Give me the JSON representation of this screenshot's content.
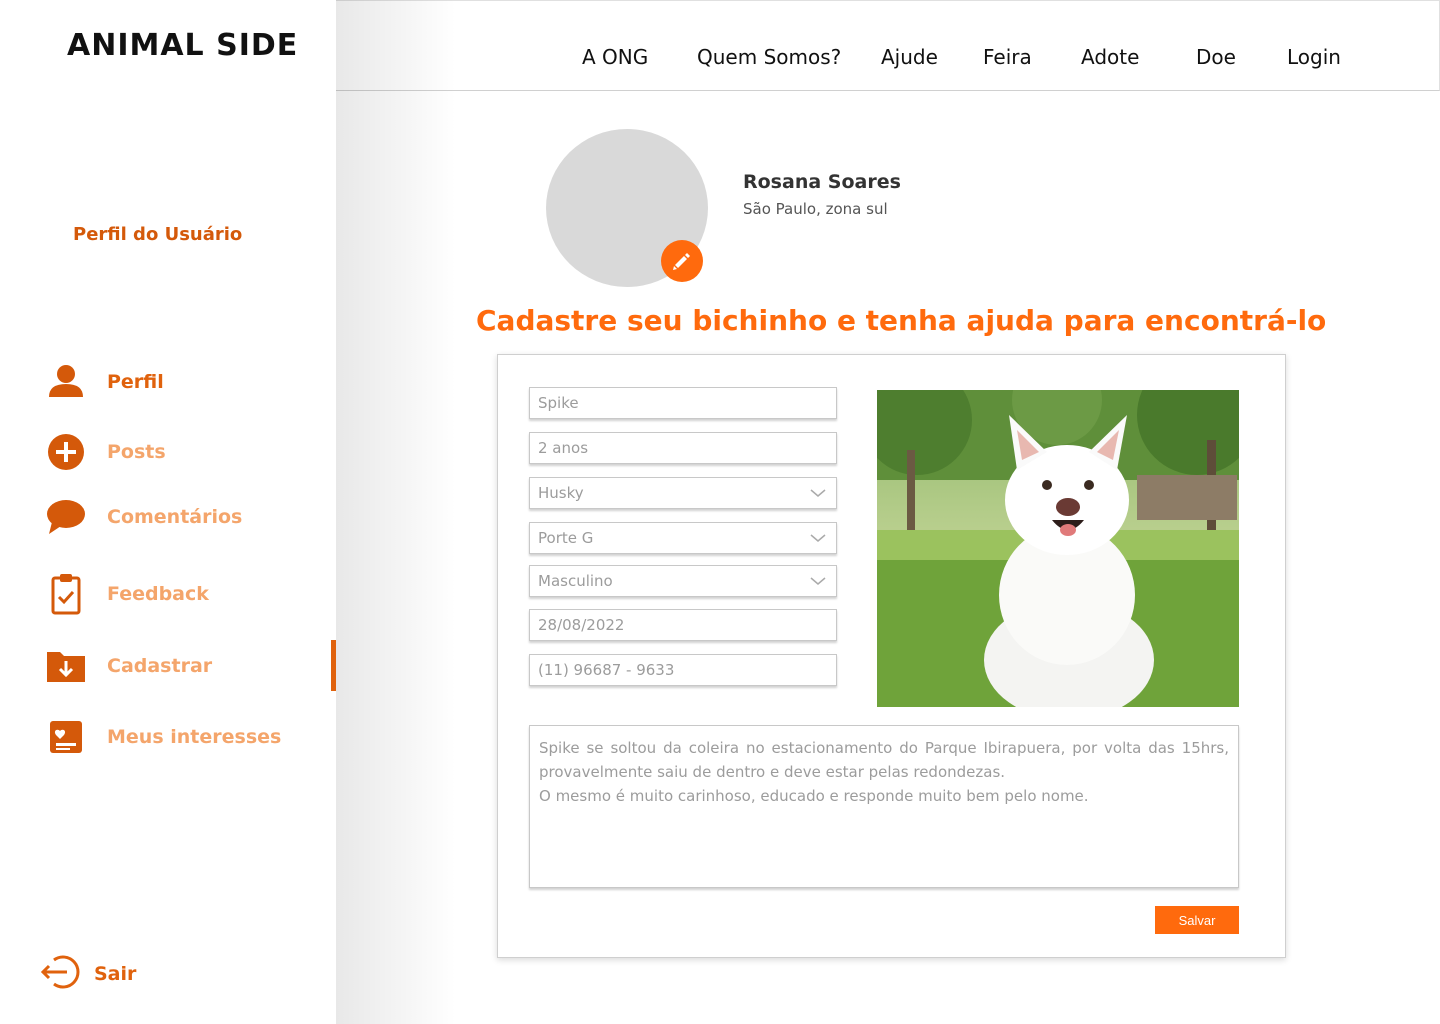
{
  "brand": {
    "logo": "ANIMAL SIDE",
    "accent": "#ff6a0d",
    "accent_dark": "#e0620d"
  },
  "sidebar": {
    "heading": "Perfil do Usuário",
    "items": [
      {
        "label": "Perfil",
        "icon": "user-icon",
        "active": true
      },
      {
        "label": "Posts",
        "icon": "plus-circle-icon"
      },
      {
        "label": "Comentários",
        "icon": "chat-bubble-icon"
      },
      {
        "label": "Feedback",
        "icon": "clipboard-check-icon"
      },
      {
        "label": "Cadastrar",
        "icon": "folder-download-icon",
        "selected": true
      },
      {
        "label": "Meus interesses",
        "icon": "heart-card-icon"
      }
    ],
    "logout_label": "Sair"
  },
  "topnav": [
    "A ONG",
    "Quem Somos?",
    "Ajude",
    "Feira",
    "Adote",
    "Doe",
    "Login"
  ],
  "profile": {
    "name": "Rosana Soares",
    "location": "São Paulo, zona sul"
  },
  "page_title": "Cadastre seu bichinho e tenha ajuda para encontrá-lo",
  "form": {
    "name": "Spike",
    "age": "2 anos",
    "breed": "Husky",
    "size": "Porte G",
    "sex": "Masculino",
    "date": "28/08/2022",
    "phone": "(11) 96687 - 9633",
    "description": "Spike se soltou da coleira no estacionamento do Parque Ibirapuera, por volta das 15hrs, provavelmente saiu de dentro e deve estar pelas redondezas.\nO mesmo é muito carinhoso, educado e responde muito bem pelo nome.",
    "save_label": "Salvar"
  }
}
